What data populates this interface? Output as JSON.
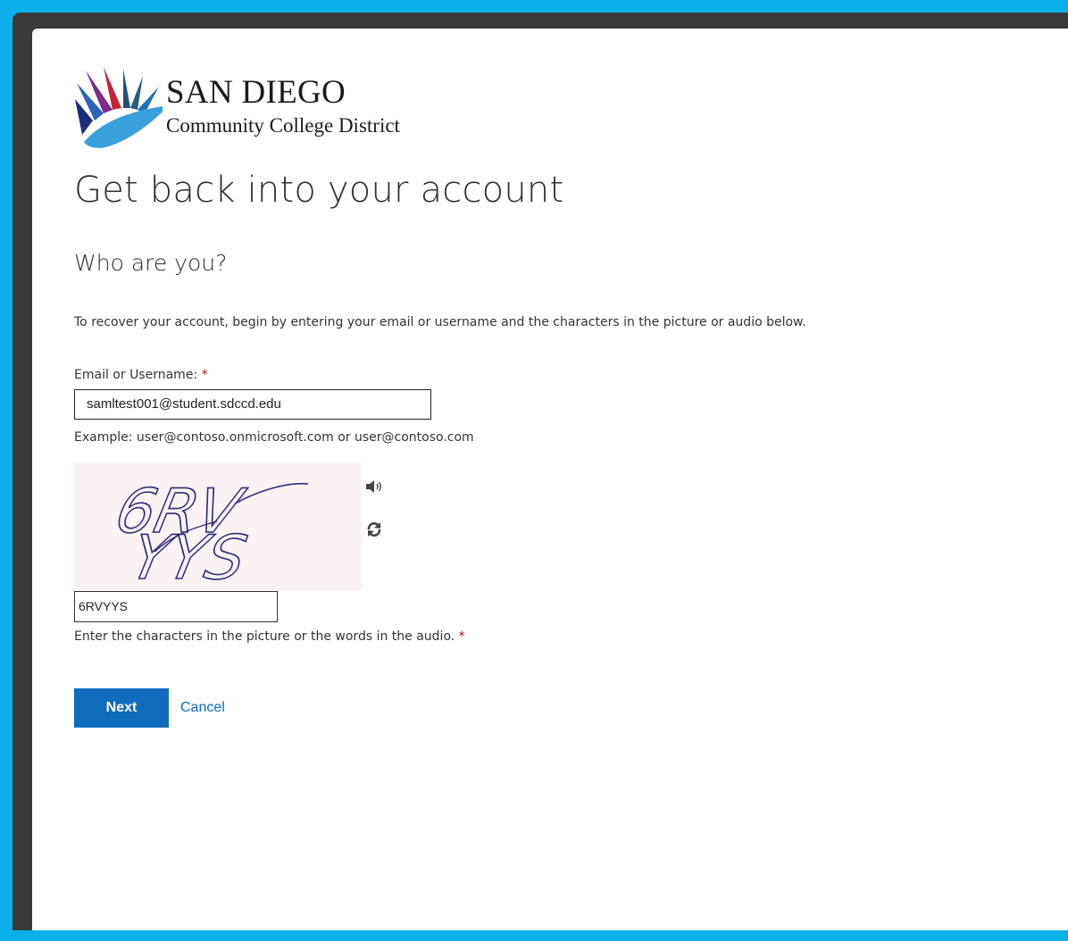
{
  "logo": {
    "title": "SAN DIEGO",
    "subtitle": "Community College District"
  },
  "page": {
    "heading": "Get back into your account",
    "subheading": "Who are you?",
    "intro": "To recover your account, begin by entering your email or username and the characters in the picture or audio below."
  },
  "email": {
    "label": "Email or Username:",
    "required_mark": "*",
    "value": "samltest001@student.sdccd.edu",
    "example": "Example: user@contoso.onmicrosoft.com or user@contoso.com"
  },
  "captcha": {
    "image_text_line1": "6RV",
    "image_text_line2": "YYS",
    "input_value": "6RVYYS",
    "help": "Enter the characters in the picture or the words in the audio.",
    "required_mark": "*",
    "icons": [
      "speaker-icon",
      "refresh-icon"
    ]
  },
  "actions": {
    "next_label": "Next",
    "cancel_label": "Cancel"
  },
  "colors": {
    "background": "#0bb0ea",
    "accent": "#0f6cbd",
    "required": "#b01010"
  }
}
